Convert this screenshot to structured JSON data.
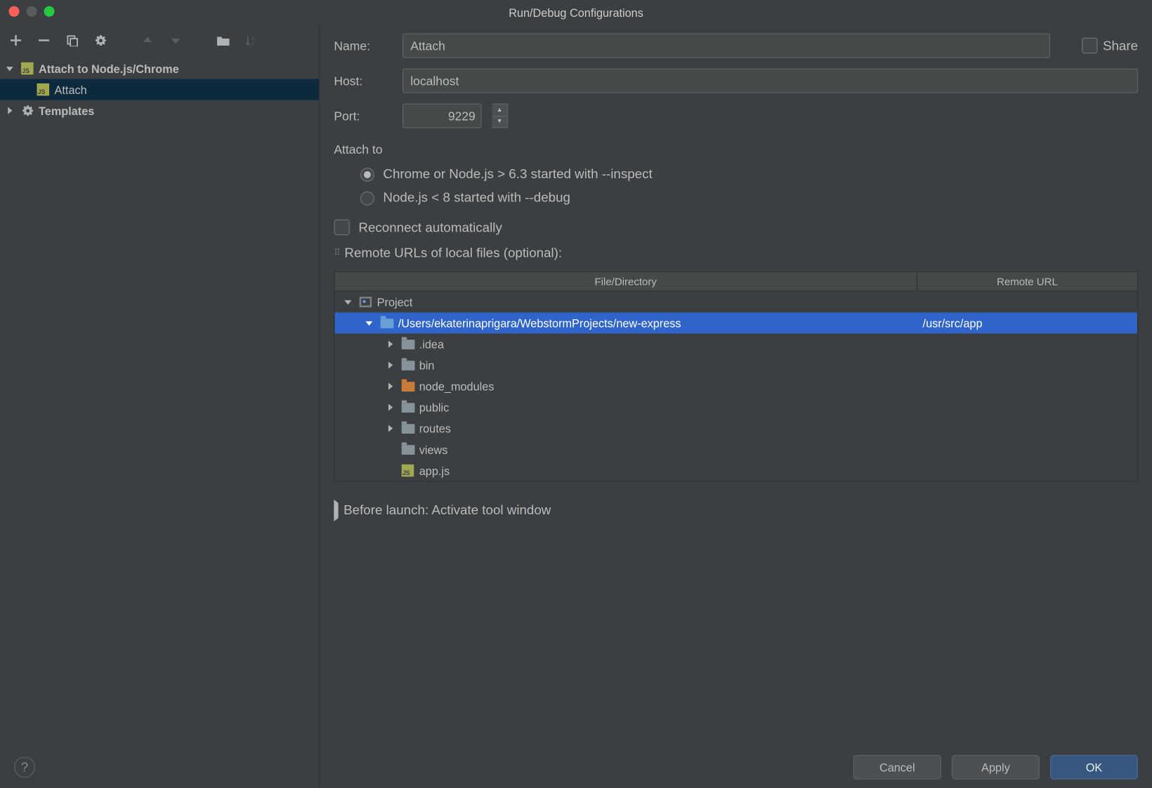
{
  "title": "Run/Debug Configurations",
  "sidebar": {
    "items": [
      {
        "label": "Attach to Node.js/Chrome",
        "children": [
          {
            "label": "Attach"
          }
        ]
      },
      {
        "label": "Templates"
      }
    ]
  },
  "form": {
    "name_label": "Name:",
    "name_value": "Attach",
    "share_label": "Share",
    "host_label": "Host:",
    "host_value": "localhost",
    "port_label": "Port:",
    "port_value": "9229",
    "attach_to_label": "Attach to",
    "radio_inspect": "Chrome or Node.js > 6.3 started with --inspect",
    "radio_debug": "Node.js < 8 started with --debug",
    "reconnect_label": "Reconnect automatically",
    "remote_urls_label": "Remote URLs of local files (optional):"
  },
  "table": {
    "header_fd": "File/Directory",
    "header_ru": "Remote URL",
    "rows": [
      {
        "indent": 0,
        "expanded": true,
        "icon": "project",
        "label": "Project",
        "remote": ""
      },
      {
        "indent": 1,
        "expanded": true,
        "icon": "folder-blue",
        "label": "/Users/ekaterinaprigara/WebstormProjects/new-express",
        "remote": "/usr/src/app",
        "selected": true
      },
      {
        "indent": 2,
        "expanded": false,
        "icon": "folder",
        "label": ".idea",
        "remote": ""
      },
      {
        "indent": 2,
        "expanded": false,
        "icon": "folder",
        "label": "bin",
        "remote": ""
      },
      {
        "indent": 2,
        "expanded": false,
        "icon": "folder-orange",
        "label": "node_modules",
        "remote": ""
      },
      {
        "indent": 2,
        "expanded": false,
        "icon": "folder",
        "label": "public",
        "remote": ""
      },
      {
        "indent": 2,
        "expanded": false,
        "icon": "folder",
        "label": "routes",
        "remote": ""
      },
      {
        "indent": 2,
        "expanded": null,
        "icon": "folder",
        "label": "views",
        "remote": ""
      },
      {
        "indent": 2,
        "expanded": null,
        "icon": "js",
        "label": "app.js",
        "remote": ""
      }
    ]
  },
  "before_launch": "Before launch: Activate tool window",
  "buttons": {
    "cancel": "Cancel",
    "apply": "Apply",
    "ok": "OK"
  }
}
